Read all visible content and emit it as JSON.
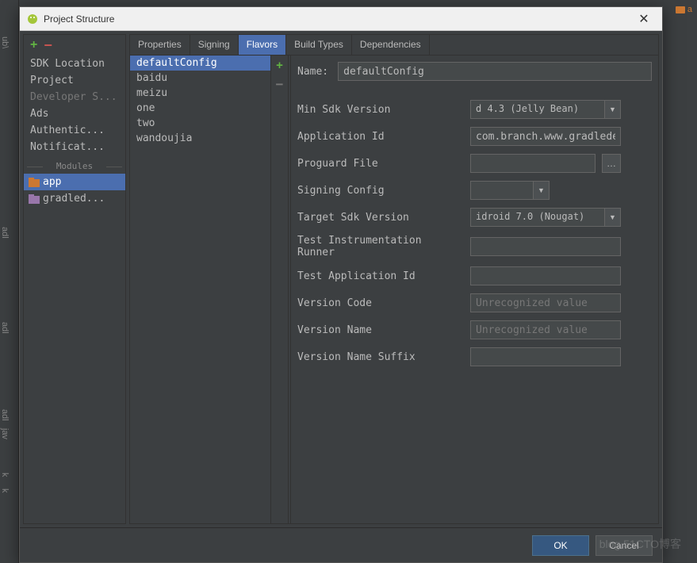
{
  "window": {
    "title": "Project Structure"
  },
  "background": {
    "gutter": [
      "ub\\",
      "adl",
      "adl",
      "adl",
      "jav",
      "k",
      "k"
    ],
    "topRight": "a"
  },
  "sidebar": {
    "items": [
      {
        "label": "SDK Location",
        "dimmed": false
      },
      {
        "label": "Project",
        "dimmed": false
      },
      {
        "label": "Developer S...",
        "dimmed": true
      },
      {
        "label": "Ads",
        "dimmed": false
      },
      {
        "label": "Authentic...",
        "dimmed": false
      },
      {
        "label": "Notificat...",
        "dimmed": false
      }
    ],
    "modulesHeader": "Modules",
    "modules": [
      {
        "label": "app",
        "selected": true,
        "iconColor": "#cc7832"
      },
      {
        "label": "gradled...",
        "selected": false,
        "iconColor": "#a9b7c6"
      }
    ]
  },
  "tabs": [
    {
      "label": "Properties",
      "active": false
    },
    {
      "label": "Signing",
      "active": false
    },
    {
      "label": "Flavors",
      "active": true
    },
    {
      "label": "Build Types",
      "active": false
    },
    {
      "label": "Dependencies",
      "active": false
    }
  ],
  "flavors": [
    {
      "label": "defaultConfig",
      "selected": true
    },
    {
      "label": "baidu",
      "selected": false
    },
    {
      "label": "meizu",
      "selected": false
    },
    {
      "label": "one",
      "selected": false
    },
    {
      "label": "two",
      "selected": false
    },
    {
      "label": "wandoujia",
      "selected": false
    }
  ],
  "detail": {
    "nameLabel": "Name:",
    "nameValue": "defaultConfig",
    "fields": {
      "minSdk": {
        "label": "Min Sdk Version",
        "value": "d 4.3 (Jelly Bean)"
      },
      "appId": {
        "label": "Application Id",
        "value": "com.branch.www.gradledemo"
      },
      "proguard": {
        "label": "Proguard File",
        "value": ""
      },
      "signing": {
        "label": "Signing Config",
        "value": ""
      },
      "targetSdk": {
        "label": "Target Sdk Version",
        "value": "idroid 7.0 (Nougat)"
      },
      "testRunner": {
        "label": "Test Instrumentation Runner",
        "value": ""
      },
      "testAppId": {
        "label": "Test Application Id",
        "value": ""
      },
      "versionCode": {
        "label": "Version Code",
        "placeholder": "Unrecognized value"
      },
      "versionName": {
        "label": "Version Name",
        "placeholder": "Unrecognized value"
      },
      "versionSuffix": {
        "label": "Version Name Suffix",
        "value": ""
      }
    }
  },
  "buttons": {
    "ok": "OK",
    "cancel": "Cancel"
  },
  "watermark": "blog.51CTO博客"
}
